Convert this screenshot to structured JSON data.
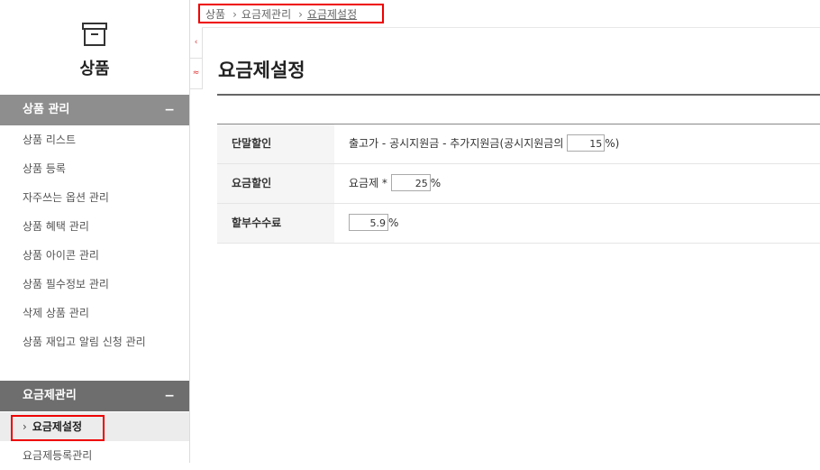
{
  "sidebar": {
    "title": "상품",
    "product_section": {
      "label": "상품 관리",
      "toggle": "−",
      "items": [
        "상품 리스트",
        "상품 등록",
        "자주쓰는 옵션 관리",
        "상품 혜택 관리",
        "상품 아이콘 관리",
        "상품 필수정보 관리",
        "삭제 상품 관리",
        "상품 재입고 알림 신청 관리"
      ]
    },
    "plan_section": {
      "label": "요금제관리",
      "toggle": "−",
      "active_item": "요금제설정",
      "items": [
        "요금제등록관리"
      ]
    }
  },
  "strip": {
    "collapse": "‹",
    "up": "≈"
  },
  "breadcrumb": {
    "items": [
      "상품",
      "요금제관리",
      "요금제설정"
    ],
    "sep": "›"
  },
  "page": {
    "title": "요금제설정",
    "rows": [
      {
        "label": "단말할인",
        "prefix": "출고가 - 공시지원금 - 추가지원금(공시지원금의",
        "value": "15",
        "suffix": "%)"
      },
      {
        "label": "요금할인",
        "prefix": "요금제 *",
        "value": "25",
        "suffix": "%"
      },
      {
        "label": "할부수수료",
        "prefix": "",
        "value": "5.9",
        "suffix": "%"
      }
    ]
  },
  "colors": {
    "highlight": "#e00000",
    "section_header": "#8e8e8e",
    "section_header_dark": "#6e6e6e"
  }
}
